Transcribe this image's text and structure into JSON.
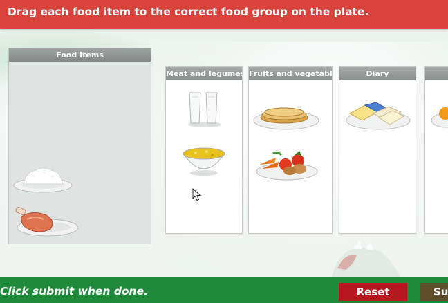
{
  "instruction": "Drag each food item to the correct food group on the plate.",
  "food_items_panel": {
    "title": "Food Items",
    "items": [
      {
        "name": "rice",
        "icon": "rice-plate-icon"
      },
      {
        "name": "ham",
        "icon": "ham-plate-icon"
      }
    ]
  },
  "food_groups": [
    {
      "label": "Meat and legumes",
      "items": [
        {
          "icon": "milk-glasses-icon"
        },
        {
          "icon": "soup-bowl-icon"
        }
      ]
    },
    {
      "label": "Fruits and vegetables",
      "items": [
        {
          "icon": "tortillas-plate-icon"
        },
        {
          "icon": "vegetables-plate-icon"
        }
      ]
    },
    {
      "label": "Diary",
      "items": [
        {
          "icon": "butter-plate-icon"
        }
      ]
    },
    {
      "label": "",
      "items": [
        {
          "icon": "orange-plate-icon"
        }
      ]
    }
  ],
  "footer": {
    "message": "Click submit when done.",
    "reset_label": "Reset",
    "submit_label": "Su"
  },
  "colors": {
    "top_bar": "#d8433c",
    "bottom_bar": "#1e8a3a",
    "reset": "#b5171c",
    "submit": "#5e4d2a"
  }
}
